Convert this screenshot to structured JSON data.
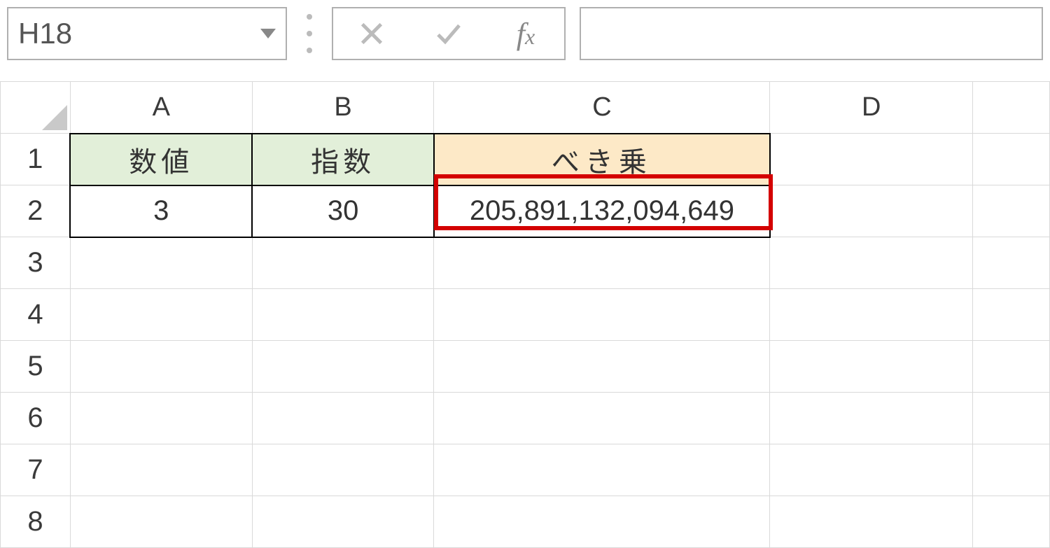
{
  "formula_bar": {
    "name_box": "H18",
    "formula_input": ""
  },
  "columns": [
    "A",
    "B",
    "C",
    "D"
  ],
  "rows": [
    "1",
    "2",
    "3",
    "4",
    "5",
    "6",
    "7",
    "8"
  ],
  "headers": {
    "A1": "数値",
    "B1": "指数",
    "C1": "べき乗"
  },
  "data": {
    "A2": "3",
    "B2": "30",
    "C2": "205,891,132,094,649"
  }
}
